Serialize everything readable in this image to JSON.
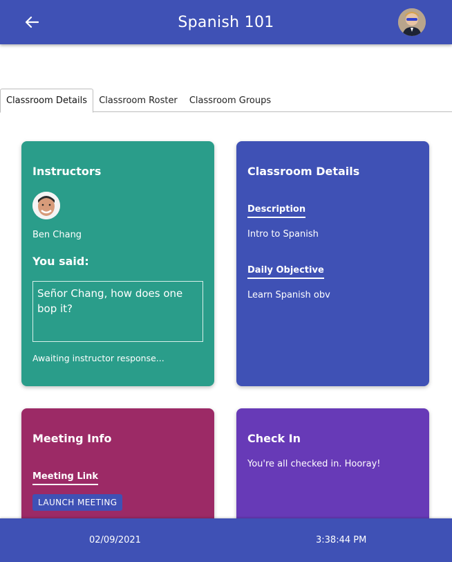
{
  "appbar": {
    "title": "Spanish 101",
    "back_icon": "arrow-left-icon",
    "avatar_icon": "user-avatar"
  },
  "tabs": [
    {
      "label": "Classroom Details",
      "active": true
    },
    {
      "label": "Classroom Roster",
      "active": false
    },
    {
      "label": "Classroom Groups",
      "active": false
    }
  ],
  "instructors_card": {
    "title": "Instructors",
    "color": "#2a9d8a",
    "instructor_name": "Ben Chang",
    "you_said_label": "You said:",
    "message": "Señor Chang, how does one bop it?",
    "status": "Awaiting instructor response..."
  },
  "details_card": {
    "title": "Classroom Details",
    "color": "#3f51b5",
    "description_label": "Description",
    "description": "Intro to Spanish",
    "objective_label": "Daily Objective",
    "objective": "Learn Spanish obv"
  },
  "meeting_card": {
    "title": "Meeting Info",
    "color": "#9c2a66",
    "link_label": "Meeting Link",
    "launch_button": "LAUNCH MEETING"
  },
  "checkin_card": {
    "title": "Check In",
    "color": "#673ab7",
    "message": "You're all checked in. Hooray!"
  },
  "footer": {
    "date": "02/09/2021",
    "time": "3:38:44 PM"
  }
}
